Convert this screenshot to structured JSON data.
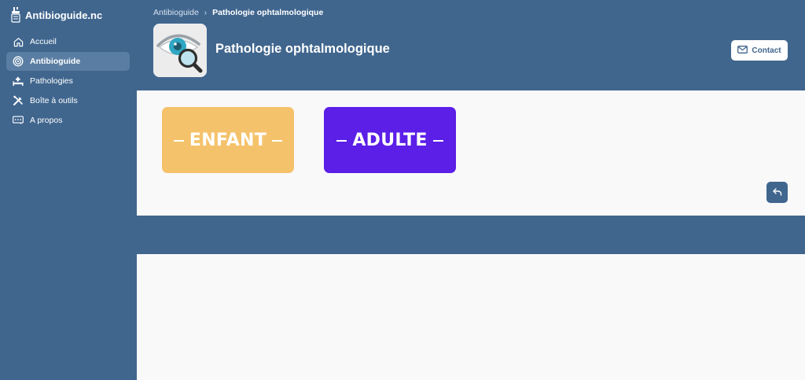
{
  "brand": {
    "name": "Antibioguide.nc",
    "logo_icon": "bottle-logo-icon"
  },
  "sidebar": {
    "items": [
      {
        "label": "Accueil",
        "icon": "home-icon",
        "active": false
      },
      {
        "label": "Antibioguide",
        "icon": "target-icon",
        "active": true
      },
      {
        "label": "Pathologies",
        "icon": "hospital-bed-icon",
        "active": false
      },
      {
        "label": "Boîte à outils",
        "icon": "tools-icon",
        "active": false
      },
      {
        "label": "A propos",
        "icon": "info-card-icon",
        "active": false
      }
    ]
  },
  "breadcrumb": {
    "parent": "Antibioguide",
    "current": "Pathologie ophtalmologique"
  },
  "header": {
    "title": "Pathologie ophtalmologique",
    "icon": "eye-magnifier-icon",
    "contact_label": "Contact",
    "contact_icon": "mail-icon"
  },
  "choices": [
    {
      "label": "ENFANT",
      "color": "#f5c26c"
    },
    {
      "label": "ADULTE",
      "color": "#5b1fe8"
    }
  ],
  "back_button": {
    "icon": "undo-arrow-icon"
  },
  "colors": {
    "primary": "#40668e",
    "active_nav": "#5a7ea3",
    "background": "#f9f9fa"
  }
}
